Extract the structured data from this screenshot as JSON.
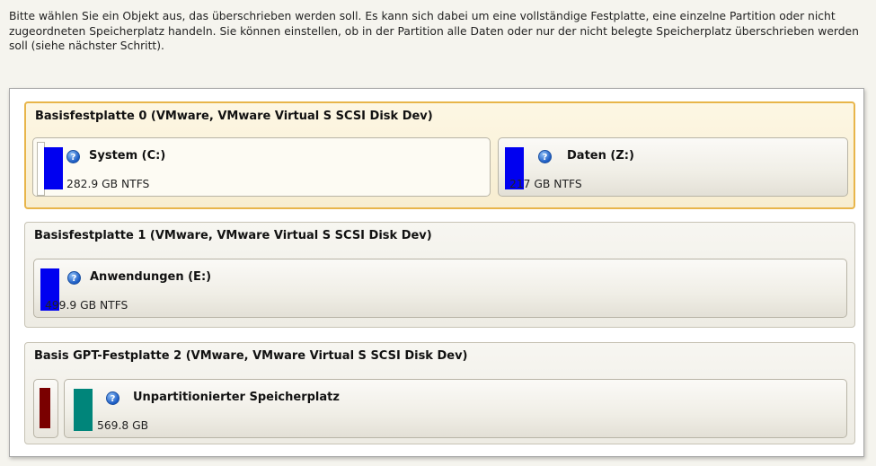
{
  "intro_text": "Bitte wählen Sie ein Objekt aus, das überschrieben werden soll. Es kann sich dabei um eine vollständige Festplatte, eine einzelne Partition oder nicht zugeordneten Speicherplatz handeln. Sie können einstellen, ob in der Partition alle Daten oder nur der nicht belegte Speicherplatz überschrieben werden soll (siehe nächster Schritt).",
  "help_glyph": "?",
  "disks": [
    {
      "title": "Basisfestplatte 0 (VMware, VMware Virtual S SCSI Disk Dev)",
      "partitions": [
        {
          "name": "System (C:)",
          "info": "282.9 GB NTFS",
          "color": "#0000f0"
        },
        {
          "name": "Daten (Z:)",
          "info": "217 GB NTFS",
          "color": "#0000f0"
        }
      ]
    },
    {
      "title": "Basisfestplatte 1 (VMware, VMware Virtual S SCSI Disk Dev)",
      "partitions": [
        {
          "name": "Anwendungen (E:)",
          "info": "499.9 GB NTFS",
          "color": "#0000f0"
        }
      ]
    },
    {
      "title": "Basis GPT-Festplatte 2 (VMware, VMware Virtual S SCSI Disk Dev)",
      "partitions": [
        {
          "name": "",
          "info": "",
          "color": "#7a0000"
        },
        {
          "name": "Unpartitionierter Speicherplatz",
          "info": "569.8 GB",
          "color": "#00857a"
        }
      ]
    }
  ],
  "colors": {
    "selection_border": "#e8b54a",
    "ntfs_partition": "#0000f0",
    "system_partition": "#7a0000",
    "unallocated": "#00857a"
  }
}
